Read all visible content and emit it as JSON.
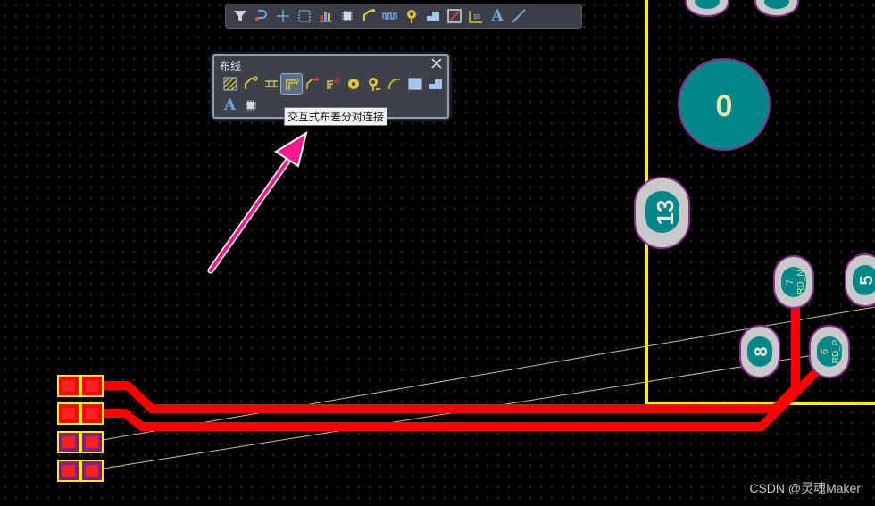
{
  "colors": {
    "trace": "#ff0000",
    "board_outline": "#ffee00",
    "pad_teal": "#00878a",
    "pad_ring_gray": "#c9c9c9",
    "pad_outline_purple": "#8b2f8d",
    "ratsnest": "#cfc48a",
    "arrow": "#ff1a8c",
    "smd_pad": "#ff0000",
    "smd_fill": "#7a1f8f"
  },
  "active_bar": {
    "items": [
      "filter-icon",
      "interactive-route-icon",
      "crosshair-icon",
      "select-rect-icon",
      "align-chart-icon",
      "component-icon",
      "route-icon",
      "length-tune-icon",
      "via-icon",
      "polygon-icon",
      "area-icon",
      "dimension-icon",
      "string-icon",
      "line-icon"
    ],
    "text_label": "A"
  },
  "route_panel": {
    "title": "布线",
    "tooltip": "交互式布差分对连接",
    "row1": [
      "autoroute-hatch-icon",
      "interactive-route-icon",
      "multi-route-icon",
      "diff-pair-route-icon",
      "gloss-icon",
      "retrace-icon",
      "pad-icon",
      "via-icon",
      "arc-icon",
      "fill-icon",
      "solid-region-icon"
    ],
    "row2_text": "A"
  },
  "pads": [
    {
      "label": "0"
    },
    {
      "label": "13"
    },
    {
      "label": "8"
    },
    {
      "label": "5"
    },
    {
      "label": "7",
      "net": "RD_N"
    },
    {
      "label": "6",
      "net": "RD_P"
    }
  ],
  "watermark": "CSDN @灵魂Maker"
}
